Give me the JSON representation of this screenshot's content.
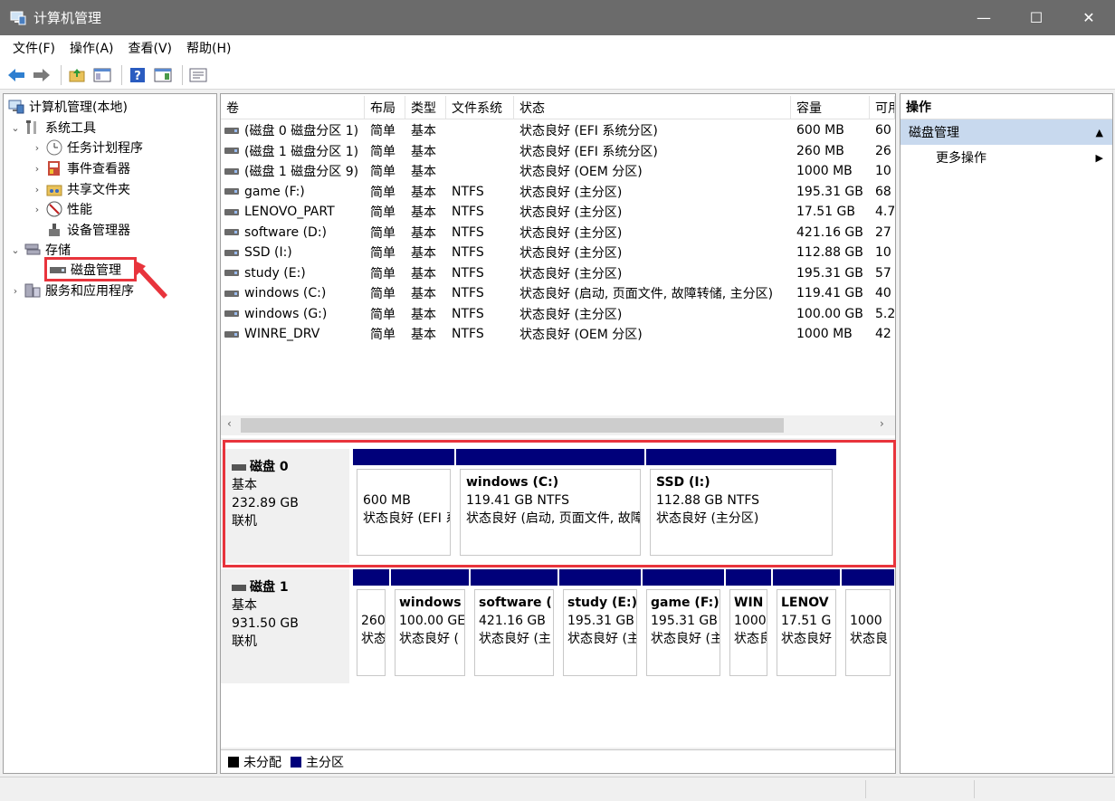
{
  "window": {
    "title": "计算机管理",
    "minimize": "—",
    "maximize": "☐",
    "close": "✕"
  },
  "menu": [
    "文件(F)",
    "操作(A)",
    "查看(V)",
    "帮助(H)"
  ],
  "tree": {
    "root": "计算机管理(本地)",
    "system_tools": "系统工具",
    "task_scheduler": "任务计划程序",
    "event_viewer": "事件查看器",
    "shared_folders": "共享文件夹",
    "performance": "性能",
    "device_manager": "设备管理器",
    "storage": "存储",
    "disk_management": "磁盘管理",
    "services_apps": "服务和应用程序"
  },
  "columns": [
    "卷",
    "布局",
    "类型",
    "文件系统",
    "状态",
    "容量",
    "可用"
  ],
  "volumes": [
    [
      "(磁盘 0 磁盘分区 1)",
      "简单",
      "基本",
      "",
      "状态良好 (EFI 系统分区)",
      "600 MB",
      "60"
    ],
    [
      "(磁盘 1 磁盘分区 1)",
      "简单",
      "基本",
      "",
      "状态良好 (EFI 系统分区)",
      "260 MB",
      "26"
    ],
    [
      "(磁盘 1 磁盘分区 9)",
      "简单",
      "基本",
      "",
      "状态良好 (OEM 分区)",
      "1000 MB",
      "10"
    ],
    [
      "game (F:)",
      "简单",
      "基本",
      "NTFS",
      "状态良好 (主分区)",
      "195.31 GB",
      "68"
    ],
    [
      "LENOVO_PART",
      "简单",
      "基本",
      "NTFS",
      "状态良好 (主分区)",
      "17.51 GB",
      "4.7"
    ],
    [
      "software (D:)",
      "简单",
      "基本",
      "NTFS",
      "状态良好 (主分区)",
      "421.16 GB",
      "27"
    ],
    [
      "SSD (I:)",
      "简单",
      "基本",
      "NTFS",
      "状态良好 (主分区)",
      "112.88 GB",
      "10"
    ],
    [
      "study (E:)",
      "简单",
      "基本",
      "NTFS",
      "状态良好 (主分区)",
      "195.31 GB",
      "57"
    ],
    [
      "windows (C:)",
      "简单",
      "基本",
      "NTFS",
      "状态良好 (启动, 页面文件, 故障转储, 主分区)",
      "119.41 GB",
      "40"
    ],
    [
      "windows (G:)",
      "简单",
      "基本",
      "NTFS",
      "状态良好 (主分区)",
      "100.00 GB",
      "5.2"
    ],
    [
      "WINRE_DRV",
      "简单",
      "基本",
      "NTFS",
      "状态良好 (OEM 分区)",
      "1000 MB",
      "42"
    ]
  ],
  "disk0": {
    "name": "磁盘 0",
    "kind": "基本",
    "size": "232.89 GB",
    "state": "联机",
    "parts": [
      {
        "name": "",
        "size": "600 MB",
        "status": "状态良好 (EFI 系"
      },
      {
        "name": "windows  (C:)",
        "size": "119.41 GB NTFS",
        "status": "状态良好 (启动, 页面文件, 故障"
      },
      {
        "name": "SSD  (I:)",
        "size": "112.88 GB NTFS",
        "status": "状态良好 (主分区)"
      }
    ]
  },
  "disk1": {
    "name": "磁盘 1",
    "kind": "基本",
    "size": "931.50 GB",
    "state": "联机",
    "parts": [
      {
        "name": "",
        "size": "260",
        "status": "状态"
      },
      {
        "name": "windows",
        "size": "100.00 GE",
        "status": "状态良好 ("
      },
      {
        "name": "software (",
        "size": "421.16 GB",
        "status": "状态良好 (主"
      },
      {
        "name": "study  (E:)",
        "size": "195.31 GB",
        "status": "状态良好 (主"
      },
      {
        "name": "game  (F:)",
        "size": "195.31 GB",
        "status": "状态良好 (主"
      },
      {
        "name": "WIN",
        "size": "1000",
        "status": "状态良"
      },
      {
        "name": "LENOV",
        "size": "17.51 G",
        "status": "状态良好"
      },
      {
        "name": "",
        "size": "1000",
        "status": "状态良"
      }
    ]
  },
  "legend": {
    "unallocated": "未分配",
    "primary": "主分区",
    "unallocated_color": "#000000",
    "primary_color": "#00007a"
  },
  "actions": {
    "title": "操作",
    "section": "磁盘管理",
    "more": "更多操作"
  }
}
